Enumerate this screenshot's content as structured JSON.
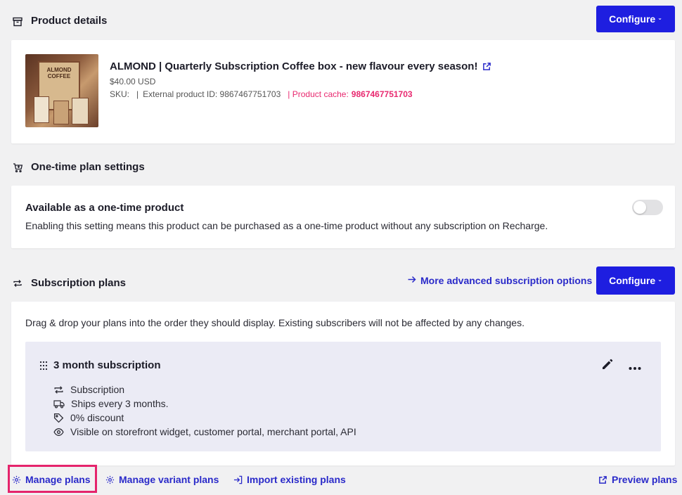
{
  "product_details": {
    "title": "Product details",
    "configure_label": "Configure",
    "product": {
      "name": "ALMOND | Quarterly Subscription Coffee box - new flavour every season!",
      "price": "$40.00 USD",
      "sku_label": "SKU:",
      "sep1": "|",
      "external_id": "External product ID: 9867467751703",
      "cache_label": "| Product cache:",
      "cache_value": "9867467751703",
      "image_text": "ALMOND COFFEE"
    }
  },
  "one_time": {
    "title": "One-time plan settings",
    "heading": "Available as a one-time product",
    "description": "Enabling this setting means this product can be purchased as a one-time product without any subscription on Recharge.",
    "enabled": false
  },
  "subscription_plans": {
    "title": "Subscription plans",
    "advanced_link": "More advanced subscription options",
    "configure_label": "Configure",
    "instructions": "Drag & drop your plans into the order they should display. Existing subscribers will not be affected by any changes.",
    "plan": {
      "name": "3 month subscription",
      "features": [
        {
          "icon": "repeat-icon",
          "text": "Subscription"
        },
        {
          "icon": "truck-icon",
          "text": "Ships every 3 months."
        },
        {
          "icon": "tag-icon",
          "text": "0% discount"
        },
        {
          "icon": "eye-icon",
          "text": "Visible on storefront widget, customer portal, merchant portal, API"
        }
      ]
    }
  },
  "footer": {
    "manage_plans": "Manage plans",
    "manage_variant_plans": "Manage variant plans",
    "import_plans": "Import existing plans",
    "preview_plans": "Preview plans"
  },
  "colors": {
    "primary": "#1e1ee0",
    "link": "#2a2ac9",
    "accent_pink": "#e8286f",
    "highlight_box": "#e5246c",
    "plan_card_bg": "#ebebf5"
  }
}
